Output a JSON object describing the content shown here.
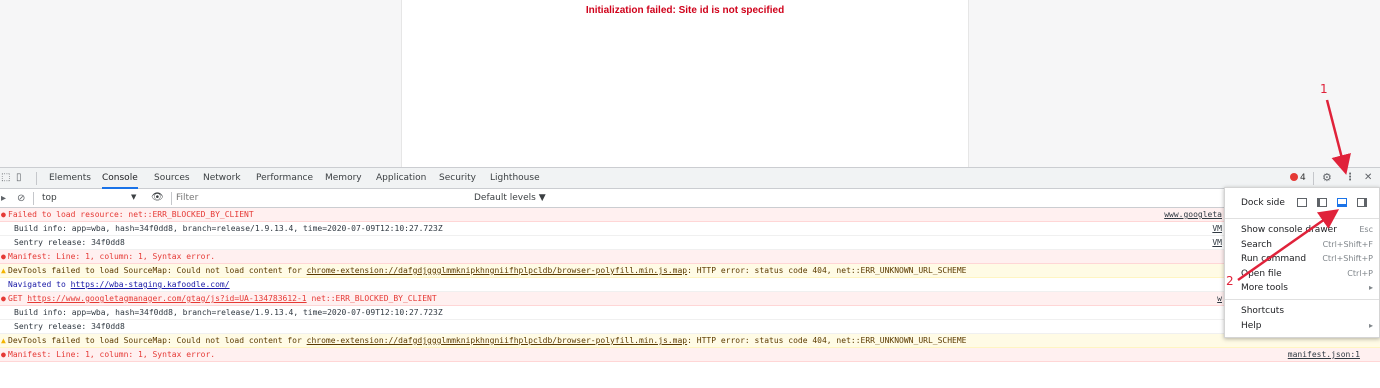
{
  "page": {
    "error_message": "Initialization failed: Site id is not specified"
  },
  "devtools": {
    "tabs": [
      "Elements",
      "Console",
      "Sources",
      "Network",
      "Performance",
      "Memory",
      "Application",
      "Security",
      "Lighthouse"
    ],
    "active_tab": "Console",
    "error_count": "4",
    "context": "top",
    "filter_placeholder": "Filter",
    "levels": "Default levels ▼"
  },
  "console": [
    {
      "type": "error",
      "text": "Failed to load resource: net::ERR_BLOCKED_BY_CLIENT",
      "source": "www.googleta"
    },
    {
      "type": "info",
      "text": "Build info: app=wba, hash=34f0dd8, branch=release/1.9.13.4, time=2020-07-09T12:10:27.723Z",
      "source": "VM"
    },
    {
      "type": "info",
      "text": "Sentry release: 34f0dd8",
      "source": "VM"
    },
    {
      "type": "error",
      "text": "Manifest: Line: 1, column: 1, Syntax error.",
      "source": ""
    },
    {
      "type": "warn",
      "text_pre": "DevTools failed to load SourceMap: Could not load content for ",
      "link": "chrome-extension://dafgdjggglmmknipkhngniifhplpcldb/browser-polyfill.min.js.map",
      "text_post": ": HTTP error: status code 404, net::ERR_UNKNOWN_URL_SCHEME",
      "source": ""
    },
    {
      "type": "nav",
      "text_pre": "Navigated to ",
      "link": "https://wba-staging.kafoodle.com/",
      "text_post": "",
      "source": ""
    },
    {
      "type": "error",
      "text_pre": "GET ",
      "link": "https://www.googletagmanager.com/gtag/js?id=UA-134783612-1",
      "text_post": " net::ERR_BLOCKED_BY_CLIENT",
      "source": "w"
    },
    {
      "type": "info",
      "text": "Build info: app=wba, hash=34f0dd8, branch=release/1.9.13.4, time=2020-07-09T12:10:27.723Z",
      "source": ""
    },
    {
      "type": "info",
      "text": "Sentry release: 34f0dd8",
      "source": ""
    },
    {
      "type": "warn",
      "text_pre": "DevTools failed to load SourceMap: Could not load content for ",
      "link": "chrome-extension://dafgdjggglmmknipkhngniifhplpcldb/browser-polyfill.min.js.map",
      "text_post": ": HTTP error: status code 404, net::ERR_UNKNOWN_URL_SCHEME",
      "source": ""
    },
    {
      "type": "error",
      "text": "Manifest: Line: 1, column: 1, Syntax error.",
      "source": "manifest.json:1"
    }
  ],
  "menu": {
    "dock_side": "Dock side",
    "items": [
      {
        "label": "Show console drawer",
        "shortcut": "Esc"
      },
      {
        "label": "Search",
        "shortcut": "Ctrl+Shift+F"
      },
      {
        "label": "Run command",
        "shortcut": "Ctrl+Shift+P"
      },
      {
        "label": "Open file",
        "shortcut": "Ctrl+P"
      },
      {
        "label": "More tools",
        "shortcut": "▸"
      }
    ],
    "items2": [
      {
        "label": "Shortcuts",
        "shortcut": ""
      },
      {
        "label": "Help",
        "shortcut": "▸"
      }
    ]
  },
  "annotations": {
    "one": "1",
    "two": "2"
  },
  "colors": {
    "annotation": "#e0223a",
    "active_tab": "#1a73e8",
    "error": "#e53935"
  }
}
